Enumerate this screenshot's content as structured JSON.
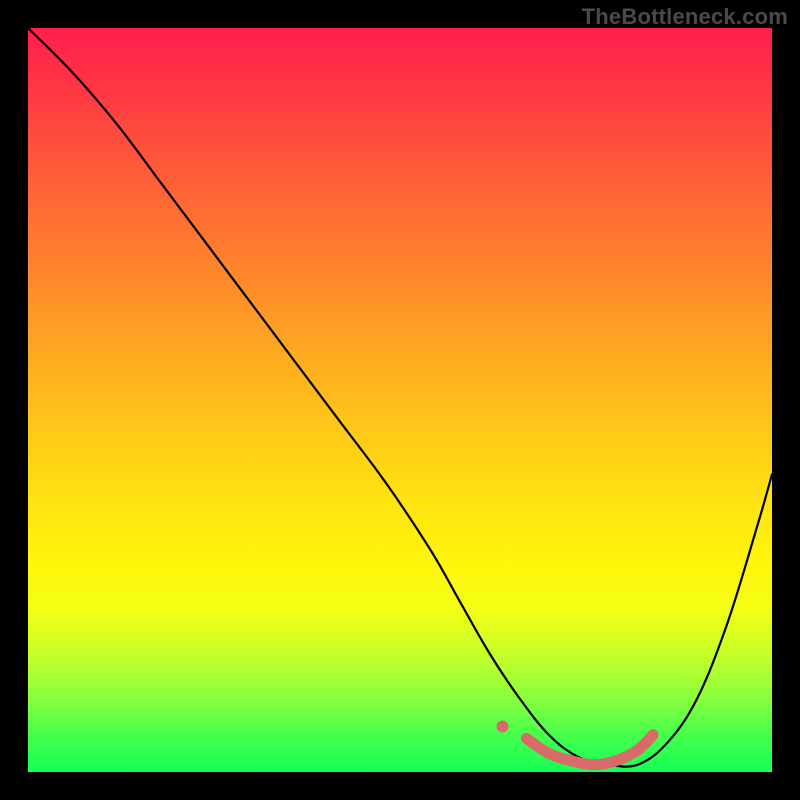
{
  "watermark": "TheBottleneck.com",
  "colors": {
    "background": "#000000",
    "gradient_top": "#ff1e4a",
    "gradient_bottom": "#14ff56",
    "curve": "#000000",
    "marker": "#d86a6a"
  },
  "chart_data": {
    "type": "line",
    "title": "",
    "xlabel": "",
    "ylabel": "",
    "xlim": [
      0,
      100
    ],
    "ylim": [
      0,
      100
    ],
    "annotations": [],
    "series": [
      {
        "name": "bottleneck-curve",
        "x": [
          0,
          6,
          12,
          18,
          24,
          30,
          36,
          42,
          48,
          54,
          58,
          62,
          66,
          70,
          74,
          78,
          82,
          86,
          90,
          94,
          98,
          100
        ],
        "y": [
          100,
          94,
          87,
          79,
          71,
          63,
          55,
          47,
          39,
          30,
          23,
          16,
          10,
          5,
          2,
          1,
          1,
          4,
          10,
          20,
          33,
          40
        ]
      }
    ],
    "markers": {
      "name": "flat-bottom-highlight",
      "x": [
        67,
        70,
        73,
        76,
        79,
        82,
        84
      ],
      "y": [
        4.5,
        2.5,
        1.5,
        1,
        1.5,
        3,
        5
      ]
    }
  }
}
